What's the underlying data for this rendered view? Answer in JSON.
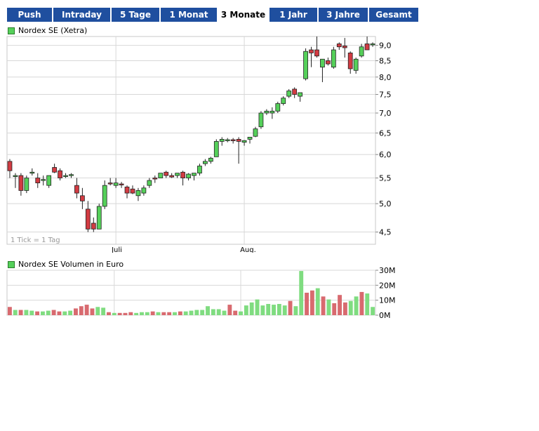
{
  "tabs": [
    {
      "label": "Push",
      "active": false
    },
    {
      "label": "Intraday",
      "active": false
    },
    {
      "label": "5 Tage",
      "active": false
    },
    {
      "label": "1 Monat",
      "active": false
    },
    {
      "label": "3 Monate",
      "active": true
    },
    {
      "label": "1 Jahr",
      "active": false
    },
    {
      "label": "3 Jahre",
      "active": false
    },
    {
      "label": "Gesamt",
      "active": false
    }
  ],
  "colors": {
    "up": "#55d05a",
    "down": "#d23b42",
    "tab_bg": "#1f4f9f",
    "grid": "#d8d8d8"
  },
  "chart_data": [
    {
      "type": "candlestick",
      "legend": "Nordex SE (Xetra)",
      "note": "1 Tick = 1 Tag",
      "x_ticks": [
        {
          "label": "Juli",
          "index": 19
        },
        {
          "label": "Aug.",
          "index": 42
        }
      ],
      "y_ticks": [
        {
          "value": 4.5,
          "label": "4,5"
        },
        {
          "value": 5.0,
          "label": "5,0"
        },
        {
          "value": 5.5,
          "label": "5,5"
        },
        {
          "value": 6.0,
          "label": "6,0"
        },
        {
          "value": 6.5,
          "label": "6,5"
        },
        {
          "value": 7.0,
          "label": "7,0"
        },
        {
          "value": 7.5,
          "label": "7,5"
        },
        {
          "value": 8.0,
          "label": "8,0"
        },
        {
          "value": 8.5,
          "label": "8,5"
        },
        {
          "value": 9.0,
          "label": "9,0"
        }
      ],
      "ylim": [
        4.3,
        9.3
      ],
      "scale": "log",
      "candles": [
        [
          5.85,
          5.9,
          5.5,
          5.65
        ],
        [
          5.55,
          5.6,
          5.3,
          5.55
        ],
        [
          5.55,
          5.6,
          5.15,
          5.25
        ],
        [
          5.25,
          5.55,
          5.2,
          5.5
        ],
        [
          5.6,
          5.7,
          5.55,
          5.62
        ],
        [
          5.5,
          5.6,
          5.3,
          5.4
        ],
        [
          5.45,
          5.55,
          5.35,
          5.47
        ],
        [
          5.35,
          5.5,
          5.3,
          5.55
        ],
        [
          5.72,
          5.8,
          5.6,
          5.62
        ],
        [
          5.65,
          5.7,
          5.45,
          5.5
        ],
        [
          5.55,
          5.6,
          5.5,
          5.55
        ],
        [
          5.55,
          5.6,
          5.5,
          5.57
        ],
        [
          5.35,
          5.5,
          5.1,
          5.2
        ],
        [
          5.15,
          5.3,
          4.9,
          5.05
        ],
        [
          4.9,
          5.05,
          4.5,
          4.55
        ],
        [
          4.65,
          4.75,
          4.5,
          4.55
        ],
        [
          4.55,
          5.0,
          4.55,
          4.95
        ],
        [
          4.95,
          5.45,
          4.9,
          5.35
        ],
        [
          5.4,
          5.5,
          5.35,
          5.38
        ],
        [
          5.35,
          5.5,
          5.3,
          5.4
        ],
        [
          5.38,
          5.42,
          5.3,
          5.36
        ],
        [
          5.32,
          5.35,
          5.1,
          5.2
        ],
        [
          5.28,
          5.35,
          5.18,
          5.2
        ],
        [
          5.15,
          5.3,
          5.05,
          5.25
        ],
        [
          5.2,
          5.35,
          5.15,
          5.3
        ],
        [
          5.35,
          5.5,
          5.3,
          5.45
        ],
        [
          5.5,
          5.55,
          5.4,
          5.48
        ],
        [
          5.5,
          5.6,
          5.5,
          5.6
        ],
        [
          5.62,
          5.65,
          5.5,
          5.55
        ],
        [
          5.55,
          5.6,
          5.5,
          5.52
        ],
        [
          5.55,
          5.6,
          5.5,
          5.6
        ],
        [
          5.62,
          5.65,
          5.35,
          5.5
        ],
        [
          5.5,
          5.6,
          5.45,
          5.58
        ],
        [
          5.55,
          5.6,
          5.45,
          5.6
        ],
        [
          5.6,
          5.8,
          5.55,
          5.75
        ],
        [
          5.8,
          5.9,
          5.75,
          5.85
        ],
        [
          5.85,
          5.95,
          5.8,
          5.92
        ],
        [
          5.95,
          6.35,
          5.95,
          6.3
        ],
        [
          6.3,
          6.4,
          6.2,
          6.35
        ],
        [
          6.32,
          6.38,
          6.28,
          6.34
        ],
        [
          6.34,
          6.38,
          6.25,
          6.32
        ],
        [
          6.35,
          6.4,
          5.8,
          6.3
        ],
        [
          6.28,
          6.33,
          6.2,
          6.32
        ],
        [
          6.35,
          6.4,
          6.25,
          6.4
        ],
        [
          6.42,
          6.65,
          6.4,
          6.6
        ],
        [
          6.65,
          7.05,
          6.6,
          7.0
        ],
        [
          7.0,
          7.1,
          6.95,
          7.05
        ],
        [
          7.0,
          7.15,
          6.85,
          7.05
        ],
        [
          7.05,
          7.3,
          7.0,
          7.25
        ],
        [
          7.25,
          7.45,
          7.2,
          7.4
        ],
        [
          7.45,
          7.65,
          7.4,
          7.6
        ],
        [
          7.65,
          7.7,
          7.4,
          7.5
        ],
        [
          7.45,
          7.55,
          7.3,
          7.55
        ],
        [
          7.95,
          8.9,
          7.9,
          8.8
        ],
        [
          8.85,
          8.95,
          8.3,
          8.75
        ],
        [
          8.85,
          9.3,
          8.6,
          8.65
        ],
        [
          8.3,
          8.55,
          7.85,
          8.55
        ],
        [
          8.5,
          8.6,
          8.35,
          8.4
        ],
        [
          8.3,
          8.95,
          8.25,
          8.85
        ],
        [
          9.05,
          9.1,
          8.85,
          8.95
        ],
        [
          8.98,
          9.25,
          8.6,
          8.92
        ],
        [
          8.75,
          8.8,
          8.1,
          8.25
        ],
        [
          8.2,
          8.6,
          8.1,
          8.55
        ],
        [
          8.65,
          9.05,
          8.6,
          8.95
        ],
        [
          9.05,
          9.3,
          8.95,
          8.85
        ],
        [
          9.05,
          9.1,
          8.95,
          9.05
        ]
      ]
    },
    {
      "type": "bar",
      "legend": "Nordex SE Volumen in Euro",
      "y_ticks": [
        {
          "value": 0,
          "label": "0M"
        },
        {
          "value": 10,
          "label": "10M"
        },
        {
          "value": 20,
          "label": "20M"
        },
        {
          "value": 30,
          "label": "30M"
        }
      ],
      "ylim": [
        0,
        30
      ],
      "unit": "M",
      "values": [
        5.5,
        3.5,
        3.5,
        3.5,
        3.0,
        2.5,
        2.5,
        3.0,
        3.5,
        2.5,
        2.5,
        3.0,
        4.5,
        6.0,
        7.0,
        4.5,
        5.5,
        5.0,
        2.0,
        1.5,
        1.5,
        1.5,
        2.0,
        1.5,
        2.0,
        2.0,
        2.5,
        2.0,
        2.0,
        2.0,
        2.0,
        2.5,
        2.5,
        3.0,
        3.5,
        3.5,
        6.0,
        4.0,
        4.0,
        3.0,
        7.0,
        3.0,
        2.5,
        6.5,
        8.5,
        10.5,
        6.5,
        7.5,
        7.0,
        7.5,
        6.5,
        9.5,
        6.0,
        29.5,
        15.0,
        16.5,
        18.0,
        12.5,
        10.5,
        8.0,
        13.5,
        8.5,
        9.5,
        12.5,
        15.5,
        14.5,
        5.5
      ]
    }
  ]
}
